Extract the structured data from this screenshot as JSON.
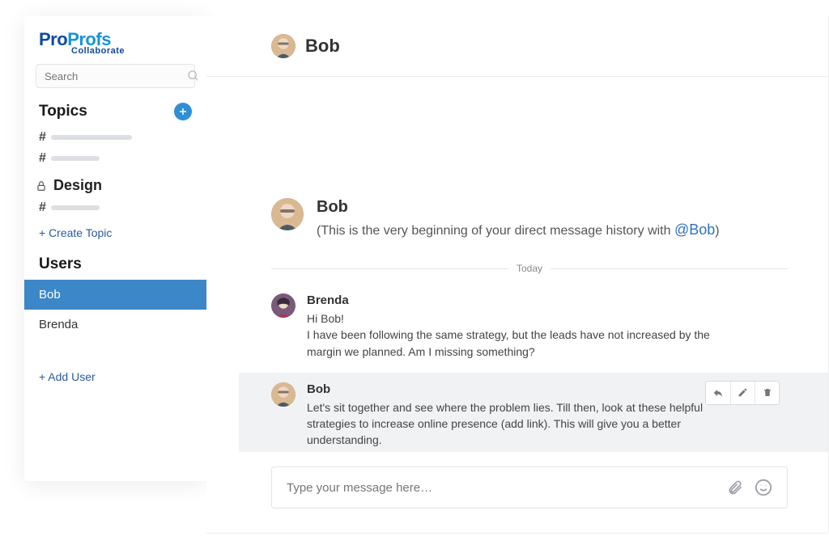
{
  "logo": {
    "pro": "Pro",
    "profs": "Profs",
    "sub": "Collaborate"
  },
  "search": {
    "placeholder": "Search"
  },
  "sidebar": {
    "topics_title": "Topics",
    "design_title": "Design",
    "create_topic": "+ Create Topic",
    "users_title": "Users",
    "users": [
      {
        "name": "Bob",
        "selected": true
      },
      {
        "name": "Brenda",
        "selected": false
      }
    ],
    "add_user": "+ Add User"
  },
  "chat": {
    "header_name": "Bob",
    "intro_name": "Bob",
    "intro_prefix": "(This is the very beginning of your direct message history with ",
    "intro_mention": "@Bob",
    "intro_suffix": ")",
    "divider": "Today",
    "messages": [
      {
        "author": "Brenda",
        "text": "Hi Bob!\nI have been following the same strategy, but the leads have not increased by the margin we planned. Am I missing something?"
      },
      {
        "author": "Bob",
        "text": "Let's sit together and see where the problem lies. Till then, look at these helpful strategies to increase online presence (add link). This will give you a better understanding."
      }
    ],
    "composer_placeholder": "Type your message here…"
  }
}
